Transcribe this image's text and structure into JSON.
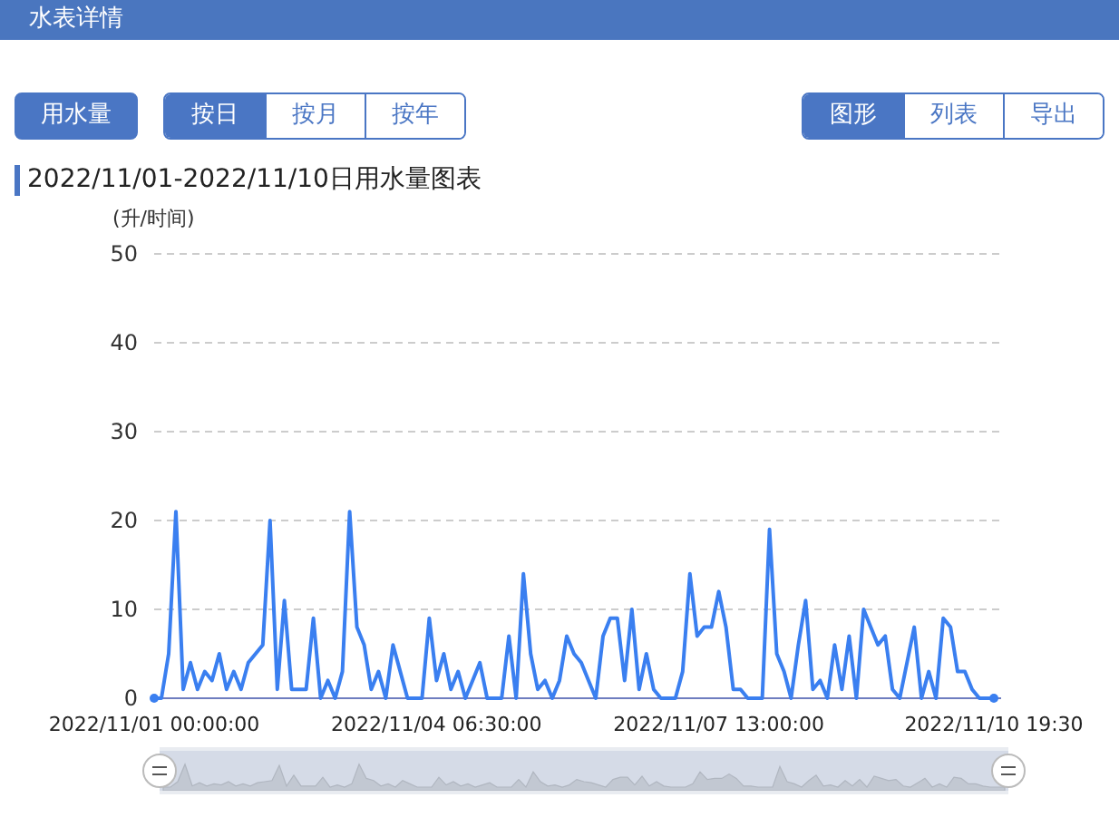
{
  "header": {
    "title": "水表详情"
  },
  "metric_button": {
    "label": "用水量",
    "selected": true
  },
  "period_tabs": [
    {
      "label": "按日",
      "selected": true
    },
    {
      "label": "按月",
      "selected": false
    },
    {
      "label": "按年",
      "selected": false
    }
  ],
  "view_tabs": [
    {
      "label": "图形",
      "selected": true
    },
    {
      "label": "列表",
      "selected": false
    },
    {
      "label": "导出",
      "selected": false
    }
  ],
  "chart": {
    "title": "2022/11/01-2022/11/10日用水量图表",
    "chart_data": {
      "type": "line",
      "grid": true,
      "categories": [
        "2022/11/01 00:00:00",
        null,
        null,
        null,
        null,
        null,
        null,
        null,
        null,
        null,
        null,
        null,
        null,
        null,
        null,
        null,
        null,
        null,
        null,
        null,
        null,
        null,
        null,
        null,
        null,
        null,
        null,
        null,
        null,
        null,
        null,
        null,
        null,
        null,
        null,
        null,
        null,
        null,
        null,
        "2022/11/04 06:30:00",
        null,
        null,
        null,
        null,
        null,
        null,
        null,
        null,
        null,
        null,
        null,
        null,
        null,
        null,
        null,
        null,
        null,
        null,
        null,
        null,
        null,
        null,
        null,
        null,
        null,
        null,
        null,
        null,
        null,
        null,
        null,
        null,
        null,
        null,
        null,
        null,
        null,
        null,
        "2022/11/07 13:00:00",
        null,
        null,
        null,
        null,
        null,
        null,
        null,
        null,
        null,
        null,
        null,
        null,
        null,
        null,
        null,
        null,
        null,
        null,
        null,
        null,
        null,
        null,
        null,
        null,
        null,
        null,
        null,
        null,
        null,
        null,
        null,
        null,
        null,
        null,
        null,
        null,
        null,
        "2022/11/10 19:30"
      ],
      "ylabel": "(升/时间)",
      "ylim": [
        0,
        50
      ],
      "yticks": [
        0,
        10,
        20,
        30,
        40,
        50
      ],
      "series": [
        {
          "color": "#3a7ff0",
          "values": [
            0,
            0,
            5,
            21,
            1,
            4,
            1,
            3,
            2,
            5,
            1,
            3,
            1,
            4,
            5,
            6,
            20,
            1,
            11,
            1,
            1,
            1,
            9,
            0,
            2,
            0,
            3,
            21,
            8,
            6,
            1,
            3,
            0,
            6,
            3,
            0,
            0,
            0,
            9,
            2,
            5,
            1,
            3,
            0,
            2,
            4,
            0,
            0,
            0,
            7,
            0,
            14,
            5,
            1,
            2,
            0,
            2,
            7,
            5,
            4,
            2,
            0,
            7,
            9,
            9,
            2,
            10,
            1,
            5,
            1,
            0,
            0,
            0,
            3,
            14,
            7,
            8,
            8,
            12,
            8,
            1,
            1,
            0,
            0,
            0,
            19,
            5,
            3,
            0,
            6,
            11,
            1,
            2,
            0,
            6,
            1,
            7,
            0,
            10,
            8,
            6,
            7,
            1,
            0,
            4,
            8,
            0,
            3,
            0,
            9,
            8,
            3,
            3,
            1,
            0,
            0,
            0
          ]
        }
      ]
    }
  },
  "zoom_slider": {
    "level": 1
  }
}
